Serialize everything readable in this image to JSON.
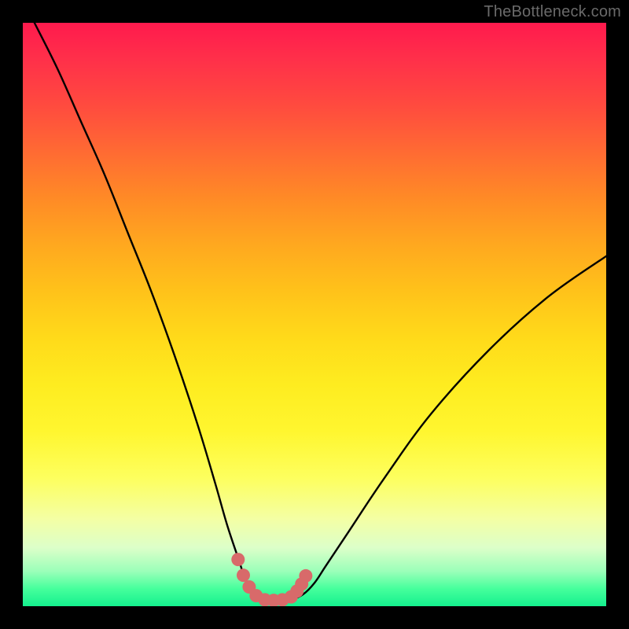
{
  "watermark": "TheBottleneck.com",
  "chart_data": {
    "type": "line",
    "title": "",
    "xlabel": "",
    "ylabel": "",
    "xlim": [
      0,
      100
    ],
    "ylim": [
      0,
      100
    ],
    "grid": false,
    "legend": false,
    "series": [
      {
        "name": "bottleneck-curve",
        "color": "#000000",
        "x": [
          2,
          6,
          10,
          14,
          18,
          22,
          26,
          30,
          33,
          35,
          37,
          38,
          39,
          40,
          42,
          44,
          46,
          48,
          50,
          52,
          56,
          62,
          70,
          80,
          90,
          100
        ],
        "y": [
          100,
          92,
          83,
          74,
          64,
          54,
          43,
          31,
          21,
          14,
          8,
          5,
          3,
          1.5,
          1,
          1,
          1.2,
          2,
          4,
          7,
          13,
          22,
          33,
          44,
          53,
          60
        ]
      },
      {
        "name": "bottleneck-highlight",
        "color": "#d86a6a",
        "style": "dots",
        "x": [
          36.9,
          37.8,
          38.8,
          40.0,
          41.5,
          43.0,
          44.5,
          46.0,
          47.0,
          47.8,
          48.5
        ],
        "y": [
          8.0,
          5.3,
          3.3,
          1.8,
          1.1,
          1.0,
          1.1,
          1.6,
          2.6,
          3.8,
          5.2
        ]
      }
    ]
  }
}
